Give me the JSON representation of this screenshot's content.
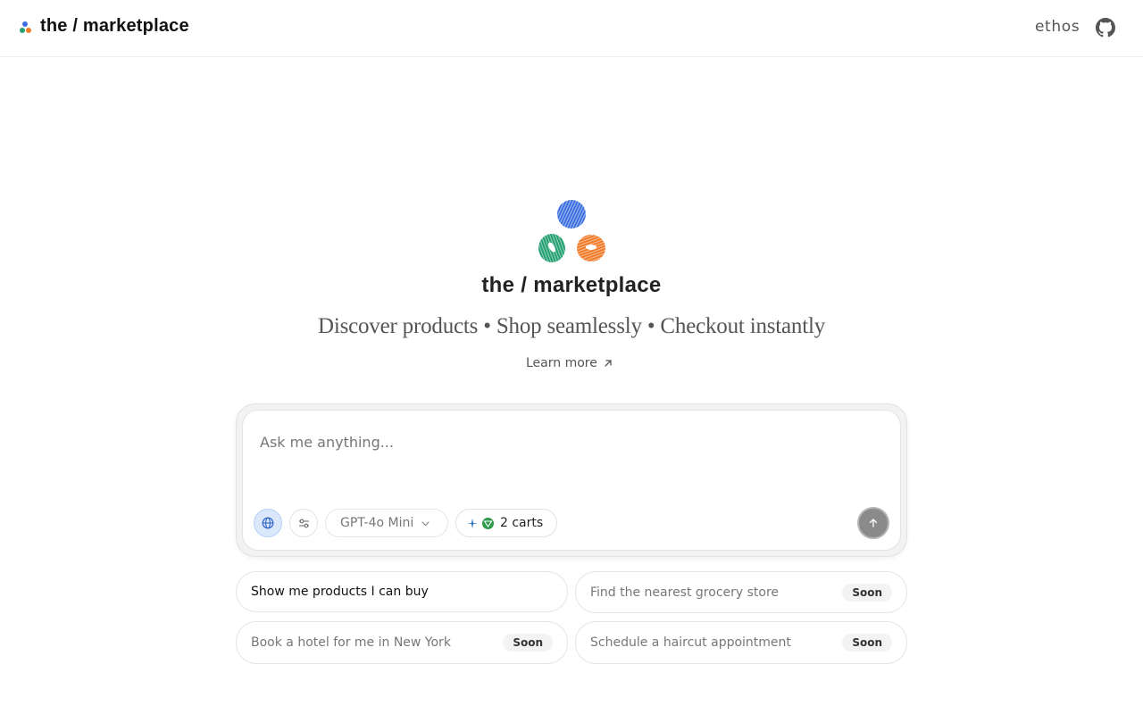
{
  "header": {
    "brand": "the / marketplace",
    "ethos_link": "ethos",
    "github_icon": "github-icon"
  },
  "hero": {
    "title": "the / marketplace",
    "tagline": "Discover products • Shop seamlessly • Checkout instantly",
    "learn_more": "Learn more"
  },
  "composer": {
    "placeholder": "Ask me anything...",
    "web_search_icon": "globe-icon",
    "settings_icon": "sliders-icon",
    "model": "GPT-4o Mini",
    "carts": "2 carts",
    "send_icon": "arrow-up-icon"
  },
  "suggestions": [
    {
      "label": "Show me products I can buy",
      "badge": ""
    },
    {
      "label": "Find the nearest grocery store",
      "badge": "Soon"
    },
    {
      "label": "Book a hotel for me in New York",
      "badge": "Soon"
    },
    {
      "label": "Schedule a haircut appointment",
      "badge": "Soon"
    }
  ],
  "colors": {
    "logo_blue": "#3b6fe0",
    "logo_green": "#25a073",
    "logo_orange": "#f07b2a"
  }
}
